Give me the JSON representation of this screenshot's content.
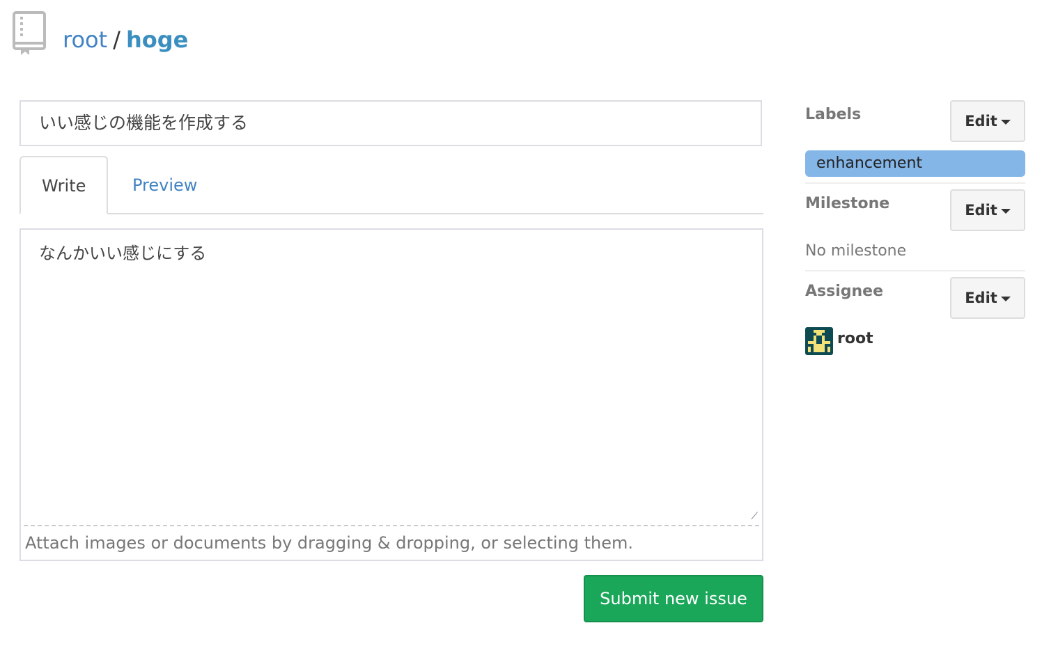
{
  "breadcrumb": {
    "owner": "root",
    "separator": "/",
    "repo": "hoge"
  },
  "issue": {
    "title": "いい感じの機能を作成する",
    "body": "なんかいい感じにする"
  },
  "tabs": {
    "write": "Write",
    "preview": "Preview"
  },
  "attach_hint": "Attach images or documents by dragging & dropping, or selecting them.",
  "submit_label": "Submit new issue",
  "sidebar": {
    "labels": {
      "heading": "Labels",
      "edit": "Edit",
      "items": [
        "enhancement"
      ]
    },
    "milestone": {
      "heading": "Milestone",
      "edit": "Edit",
      "value": "No milestone"
    },
    "assignee": {
      "heading": "Assignee",
      "edit": "Edit",
      "name": "root"
    }
  },
  "colors": {
    "accent": "#4183c4",
    "submit": "#1ba75a",
    "label": "#84b6e8"
  }
}
